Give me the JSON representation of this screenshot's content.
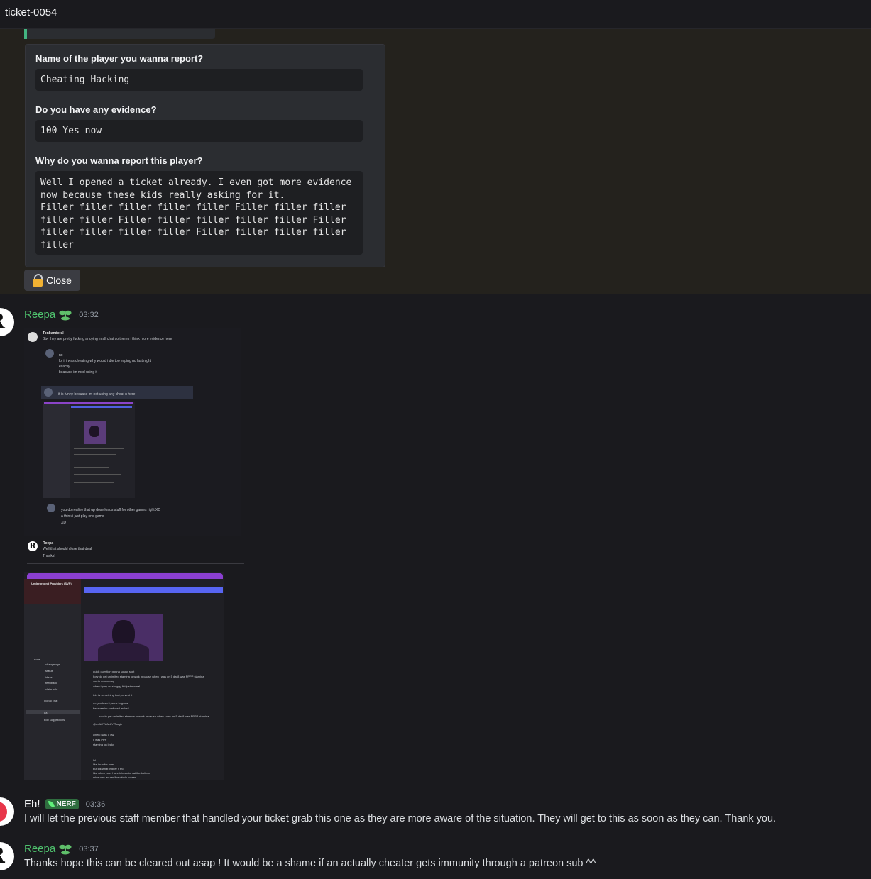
{
  "channel": {
    "title": "ticket-0054"
  },
  "form": {
    "fields": [
      {
        "label": "Name of the player you wanna report?",
        "value": "Cheating Hacking"
      },
      {
        "label": "Do you have any evidence?",
        "value": "100 Yes now"
      },
      {
        "label": "Why do you wanna report this player?",
        "value": "Well I opened a ticket already. I even got more evidence\nnow because these kids really asking for it.\nFiller filler filler filler filler Filler filler filler\nfiller filler Filler filler filler filler filler Filler\nfiller filler filler filler Filler filler filler filler\nfiller"
      }
    ],
    "close_label": "Close"
  },
  "messages": [
    {
      "author": "Reepa",
      "time": "03:32",
      "text": ""
    },
    {
      "author": "Eh!",
      "role": "NERF",
      "time": "03:36",
      "text": "I will let the previous staff member that handled your ticket grab this one as they are more aware of the situation. They will get to this as soon as they can. Thank you."
    },
    {
      "author": "Reepa",
      "time": "03:37",
      "text": "Thanks hope this can be cleared out asap ! It would be a shame if an actually cheater gets immunity through a patreon sub ^^"
    }
  ],
  "screenshot_attachment": {
    "quote_author": "Tonbanderal",
    "quote_text": "Btw they are pretty fucking anoying in all chat so theres i think more evidence here",
    "nested_lines": [
      "no",
      "lol if i was cheating why would i die too exping no last night",
      "exactly",
      "beacuse im mod using it"
    ],
    "nested_line_2": "it is funny becuase im not using any cheat n here",
    "nested_lines_3": [
      "you do realize that up dose loads stuff for other games right XD",
      "a think i just play one game",
      "XD"
    ],
    "reply_author": "Reepa",
    "reply_lines": [
      "Well that should close that deal",
      "Thanks!"
    ],
    "server_name": "Underground Providers (SVP)",
    "sidebar_items": [
      "none",
      "changelogs",
      "status",
      "ideas",
      "feedback",
      "claim-role",
      "global chat",
      "ua",
      "bob suggestions"
    ],
    "chat_lines": [
      "quick question gonna sound stolt",
      "how do get unlimited stamina to work because when i was on 5 dw 8 was PPPP stamina",
      "am th was wrong",
      "when i play on shaggy list just normal",
      "this is something that prevent it",
      "do you how it prevs in game",
      "because im confused as hell",
      "how to get unlimited stamina to work because when i was on 5 dw 8 was PPPP stamina",
      "@ru ACTUALLY Tough",
      "when i was 5 dw",
      "it was PPP",
      "stamina on leaky",
      "lol",
      "like i run for ever",
      "but idk what trigger it tho",
      "like when yous have interaction at the bottom",
      "mine was an ran like whole screen"
    ]
  }
}
